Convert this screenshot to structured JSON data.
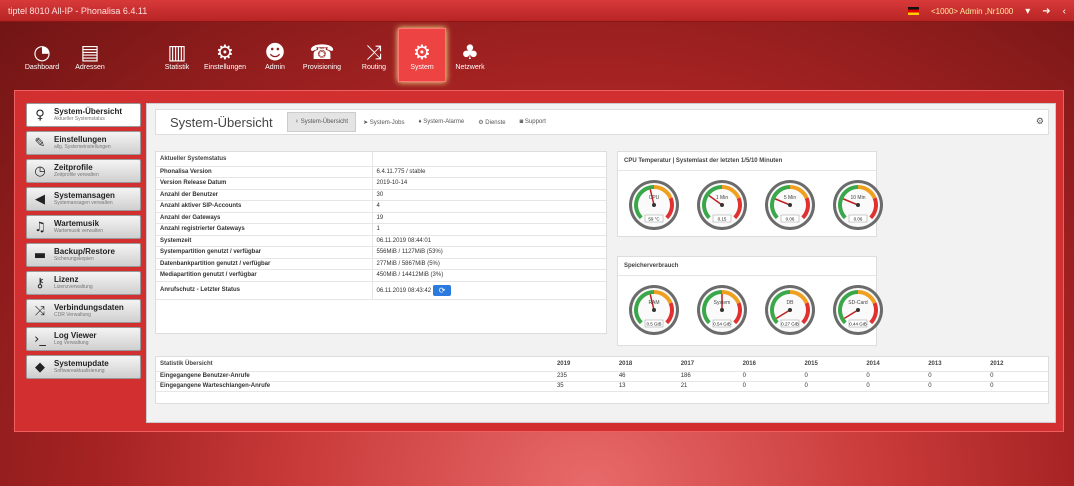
{
  "window_title": "tiptel 8010 All-IP - Phonalisa 6.4.11",
  "user_label": "<1000> Admin ,Nr1000",
  "nav": [
    {
      "label": "Dashboard",
      "icon": "dashboard-icon"
    },
    {
      "label": "Adressen",
      "icon": "address-book-icon"
    },
    {
      "label": "Statistik",
      "icon": "bar-chart-icon"
    },
    {
      "label": "Einstellungen",
      "icon": "gear-icon"
    },
    {
      "label": "Admin",
      "icon": "users-icon"
    },
    {
      "label": "Provisioning",
      "icon": "phone-icon"
    },
    {
      "label": "Routing",
      "icon": "shuffle-icon"
    },
    {
      "label": "System",
      "icon": "gears-icon"
    },
    {
      "label": "Netzwerk",
      "icon": "network-icon"
    }
  ],
  "sidebar": [
    {
      "label": "System-Übersicht",
      "sub": "Aktueller Systemstatus",
      "icon": "lightbulb-icon"
    },
    {
      "label": "Einstellungen",
      "sub": "allg. Systemeinstellungen",
      "icon": "wrench-icon"
    },
    {
      "label": "Zeitprofile",
      "sub": "Zeitprofile verwalten",
      "icon": "clock-icon"
    },
    {
      "label": "Systemansagen",
      "sub": "Systemansagen verwalten",
      "icon": "megaphone-icon"
    },
    {
      "label": "Wartemusik",
      "sub": "Wartemusik verwalten",
      "icon": "music-icon"
    },
    {
      "label": "Backup/Restore",
      "sub": "Sicherungskopien",
      "icon": "archive-icon"
    },
    {
      "label": "Lizenz",
      "sub": "Lizenzverwaltung",
      "icon": "key-icon"
    },
    {
      "label": "Verbindungsdaten",
      "sub": "CDR Verwaltung",
      "icon": "shuffle-icon"
    },
    {
      "label": "Log Viewer",
      "sub": "Log Verwaltung",
      "icon": "terminal-icon"
    },
    {
      "label": "Systemupdate",
      "sub": "Softwareaktualisierung",
      "icon": "tags-icon"
    }
  ],
  "page_title": "System-Übersicht",
  "tabs": [
    {
      "label": "System-Übersicht",
      "icon": "lightbulb-icon"
    },
    {
      "label": "System-Jobs",
      "icon": "send-icon"
    },
    {
      "label": "System-Alarme",
      "icon": "bell-icon"
    },
    {
      "label": "Dienste",
      "icon": "gears-icon"
    },
    {
      "label": "Support",
      "icon": "support-icon"
    }
  ],
  "status": {
    "header": "Aktueller Systemstatus",
    "rows": [
      {
        "k": "Phonalisa Version",
        "v": "6.4.11.775 / stable"
      },
      {
        "k": "Version Release Datum",
        "v": "2019-10-14"
      },
      {
        "k": "Anzahl der Benutzer",
        "v": "30"
      },
      {
        "k": "Anzahl aktiver SIP-Accounts",
        "v": "4"
      },
      {
        "k": "Anzahl der Gateways",
        "v": "19"
      },
      {
        "k": "Anzahl registrierter Gateways",
        "v": "1"
      },
      {
        "k": "Systemzeit",
        "v": "06.11.2019 08:44:01"
      },
      {
        "k": "Systempartition genutzt / verfügbar",
        "v": "556MiB / 1127MiB (53%)"
      },
      {
        "k": "Datenbankpartition genutzt / verfügbar",
        "v": "277MiB / 5867MiB (5%)"
      },
      {
        "k": "Mediapartition genutzt / verfügbar",
        "v": "450MiB / 14412MiB (3%)"
      },
      {
        "k": "Anrufschutz - Letzter Status",
        "v": "06.11.2019 08:43:42"
      }
    ]
  },
  "cpu": {
    "title": "CPU Temperatur | Systemlast der letzten 1/5/10 Minuten",
    "gauges": [
      {
        "label": "CPU",
        "value": "59 °C",
        "level": 0.45
      },
      {
        "label": "1 Min",
        "value": "0.15",
        "level": 0.3
      },
      {
        "label": "5 Min",
        "value": "0.06",
        "level": 0.25
      },
      {
        "label": "10 Min",
        "value": "0.06",
        "level": 0.25
      }
    ]
  },
  "storage": {
    "title": "Speicherverbrauch",
    "gauges": [
      {
        "label": "RAM",
        "value": "0.5 GiB",
        "level": 0.45
      },
      {
        "label": "System",
        "value": "0.54 GiB",
        "level": 0.5
      },
      {
        "label": "DB",
        "value": "0.27 GiB",
        "level": 0.05
      },
      {
        "label": "SD-Card",
        "value": "0.44 GiB",
        "level": 0.05
      }
    ]
  },
  "stats": {
    "header": "Statistik Übersicht",
    "years": [
      "2019",
      "2018",
      "2017",
      "2016",
      "2015",
      "2014",
      "2013",
      "2012"
    ],
    "rows": [
      {
        "k": "Eingegangene Benutzer-Anrufe",
        "v": [
          "235",
          "46",
          "186",
          "0",
          "0",
          "0",
          "0",
          "0"
        ]
      },
      {
        "k": "Eingegangene Warteschlangen-Anrufe",
        "v": [
          "35",
          "13",
          "21",
          "0",
          "0",
          "0",
          "0",
          "0"
        ]
      }
    ]
  }
}
